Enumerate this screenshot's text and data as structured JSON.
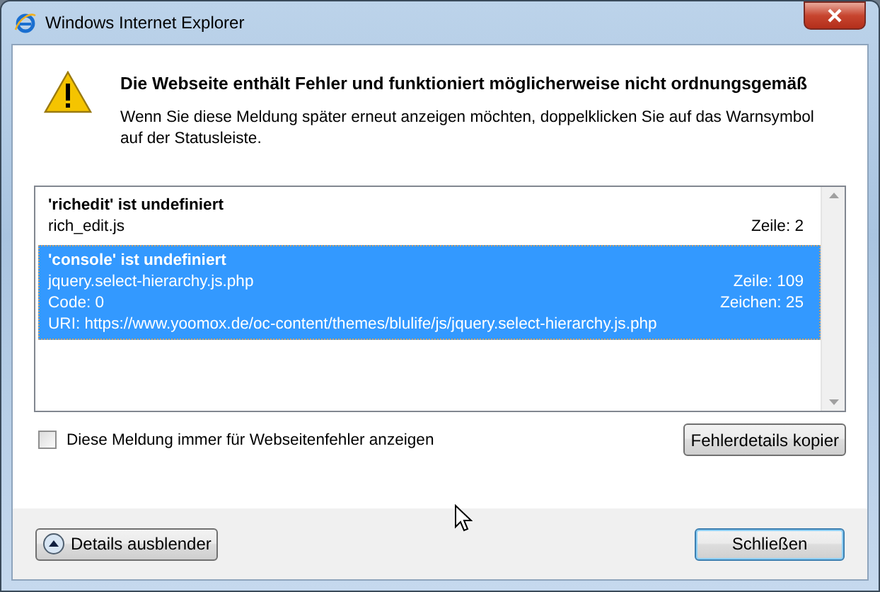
{
  "window": {
    "title": "Windows Internet Explorer"
  },
  "heading": "Die Webseite enthält Fehler und funktioniert möglicherweise nicht ordnungsgemäß",
  "message": "Wenn Sie diese Meldung später erneut anzeigen möchten, doppelklicken Sie auf das Warnsymbol auf der Statusleiste.",
  "errors": [
    {
      "title": "'richedit' ist undefiniert",
      "file": "rich_edit.js",
      "line": "Zeile: 2",
      "selected": false
    },
    {
      "title": "'console' ist undefiniert",
      "file": "jquery.select-hierarchy.js.php",
      "line": "Zeile: 109",
      "code": "Code: 0",
      "char": "Zeichen: 25",
      "uri": "URI: https://www.yoomox.de/oc-content/themes/blulife/js/jquery.select-hierarchy.js.php",
      "selected": true
    }
  ],
  "always_show": {
    "label": "Diese Meldung immer für Webseitenfehler anzeigen",
    "checked": false
  },
  "copy_button": "Fehlerdetails kopier",
  "details_button": {
    "label": "Details ausblender",
    "expanded": true
  },
  "close_button": "Schließen"
}
